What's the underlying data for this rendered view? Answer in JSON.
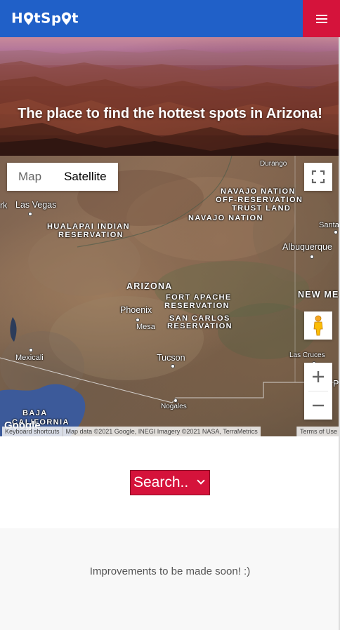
{
  "navbar": {
    "brand": "HotSpot",
    "accent_color": "#2060c8",
    "menu_color": "#d5133b",
    "menu_icon": "hamburger-icon"
  },
  "hero": {
    "title": "The place to find the hottest spots in Arizona!"
  },
  "map": {
    "type_controls": {
      "map_label": "Map",
      "satellite_label": "Satellite",
      "selected": "Satellite"
    },
    "labels": {
      "durango": "Durango",
      "navajo_nation_off1": "NAVAJO NATION",
      "navajo_nation_off2": "OFF-RESERVATION",
      "navajo_nation_off3": "TRUST LAND",
      "navajo_nation": "NAVAJO NATION",
      "las_vegas": "Las Vegas",
      "park": "rk",
      "hualapai1": "HUALAPAI INDIAN",
      "hualapai2": "RESERVATION",
      "santa": "Santa",
      "albuquerque": "Albuquerque",
      "arizona": "ARIZONA",
      "new_mexico": "NEW ME",
      "fort_apache1": "FORT APACHE",
      "fort_apache2": "RESERVATION",
      "phoenix": "Phoenix",
      "mesa": "Mesa",
      "san_carlos1": "SAN CARLOS",
      "san_carlos2": "RESERVATION",
      "mexicali": "Mexicali",
      "tucson": "Tucson",
      "las_cruces": "Las Cruces",
      "nogales": "Nogales",
      "baja1": "BAJA",
      "baja2": "CALIFORNIA",
      "edge_p": "P"
    },
    "google": "Google",
    "attribution": {
      "shortcuts": "Keyboard shortcuts",
      "data": "Map data ©2021 Google, INEGI Imagery ©2021 NASA, TerraMetrics",
      "terms": "Terms of Use"
    },
    "icons": {
      "fullscreen": "fullscreen-icon",
      "pegman": "pegman-icon",
      "zoom_in": "plus-icon",
      "zoom_out": "minus-icon"
    }
  },
  "search": {
    "selected_option": "Search.."
  },
  "footer": {
    "text": "Improvements to be made soon! :)"
  }
}
